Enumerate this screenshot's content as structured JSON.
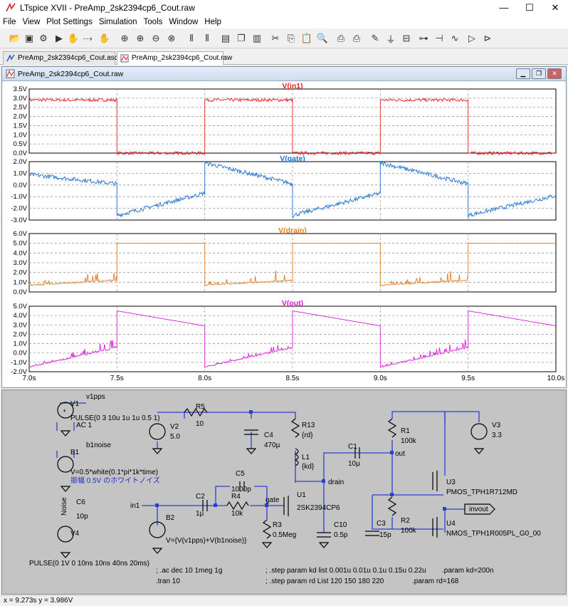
{
  "window": {
    "title": "LTspice XVII - PreAmp_2sk2394cp6_Cout.raw",
    "minimize": "—",
    "maximize": "☐",
    "close": "✕"
  },
  "menu": [
    "File",
    "View",
    "Plot Settings",
    "Simulation",
    "Tools",
    "Window",
    "Help"
  ],
  "toolbar_icons": [
    "open-icon",
    "save-icon",
    "settings-icon",
    "run-icon",
    "halt-icon",
    "run2-icon",
    "pan-icon",
    "zoom-in-icon",
    "zoom-in2-icon",
    "zoom-out-icon",
    "zoom-cancel-icon",
    "autorange-icon",
    "autorange2-icon",
    "tile-h-icon",
    "cascade-icon",
    "tile-v-icon",
    "cut-icon",
    "copy-icon",
    "paste-icon",
    "find-icon",
    "print-icon",
    "print-setup-icon",
    "pencil-icon",
    "ground-icon",
    "label-icon",
    "resistor-icon",
    "capacitor-icon",
    "inductor-icon",
    "diode-icon",
    "component-icon"
  ],
  "tabs": [
    {
      "label": "PreAmp_2sk2394cp6_Cout.asc"
    },
    {
      "label": "PreAmp_2sk2394cp6_Cout.raw"
    }
  ],
  "plot_window": {
    "title": "PreAmp_2sk2394cp6_Cout.raw"
  },
  "chart_data": [
    {
      "type": "line",
      "title": "V(in1)",
      "color": "#e8211e",
      "yticks": [
        "3.5V",
        "3.0V",
        "2.5V",
        "2.0V",
        "1.5V",
        "1.0V",
        "0.5V",
        "0.0V"
      ],
      "ylim": [
        0,
        3.5
      ],
      "xlim": [
        7.0,
        10.0
      ],
      "series": [
        {
          "name": "V(in1)",
          "segments": [
            [
              7.0,
              2.9
            ],
            [
              7.5,
              2.9
            ],
            [
              7.5,
              0.0
            ],
            [
              8.0,
              0.0
            ],
            [
              8.0,
              2.9
            ],
            [
              8.5,
              2.9
            ],
            [
              8.5,
              0.0
            ],
            [
              9.0,
              0.0
            ],
            [
              9.0,
              2.9
            ],
            [
              9.5,
              2.9
            ],
            [
              9.5,
              0.0
            ],
            [
              10.0,
              0.0
            ]
          ]
        }
      ]
    },
    {
      "type": "line",
      "title": "V(gate)",
      "color": "#1f6fd6",
      "yticks": [
        "2.0V",
        "1.0V",
        "0.0V",
        "-1.0V",
        "-2.0V",
        "-3.0V"
      ],
      "ylim": [
        -3.0,
        2.0
      ],
      "xlim": [
        7.0,
        10.0
      ],
      "series": [
        {
          "name": "V(gate)",
          "segments": [
            [
              7.0,
              0.9
            ],
            [
              7.5,
              0.1
            ],
            [
              7.5,
              -2.6
            ],
            [
              8.0,
              -0.7
            ],
            [
              8.0,
              1.9
            ],
            [
              8.5,
              0.1
            ],
            [
              8.5,
              -2.6
            ],
            [
              9.0,
              -0.7
            ],
            [
              9.0,
              1.9
            ],
            [
              9.5,
              0.1
            ],
            [
              9.5,
              -2.6
            ],
            [
              10.0,
              -0.9
            ]
          ]
        }
      ]
    },
    {
      "type": "line",
      "title": "V(drain)",
      "color": "#e87a1e",
      "yticks": [
        "6.0V",
        "5.0V",
        "4.0V",
        "3.0V",
        "2.0V",
        "1.0V",
        "0.0V"
      ],
      "ylim": [
        0,
        6.0
      ],
      "xlim": [
        7.0,
        10.0
      ],
      "series": [
        {
          "name": "V(drain)",
          "segments": [
            [
              7.0,
              0.7
            ],
            [
              7.5,
              1.2
            ],
            [
              7.5,
              5.0
            ],
            [
              8.0,
              5.0
            ],
            [
              8.0,
              0.7
            ],
            [
              8.5,
              1.2
            ],
            [
              8.5,
              5.0
            ],
            [
              9.0,
              5.0
            ],
            [
              9.0,
              0.7
            ],
            [
              9.5,
              1.2
            ],
            [
              9.5,
              5.0
            ],
            [
              10.0,
              5.0
            ]
          ]
        }
      ]
    },
    {
      "type": "line",
      "title": "V(out)",
      "color": "#d81bd8",
      "yticks": [
        "5.0V",
        "4.0V",
        "3.0V",
        "2.0V",
        "1.0V",
        "0.0V",
        "-1.0V",
        "-2.0V"
      ],
      "ylim": [
        -2.0,
        5.0
      ],
      "xlim": [
        7.0,
        10.0
      ],
      "xticks": [
        "7.0s",
        "7.5s",
        "8.0s",
        "8.5s",
        "9.0s",
        "9.5s",
        "10.0s"
      ],
      "series": [
        {
          "name": "V(out)",
          "segments": [
            [
              7.0,
              -1.5
            ],
            [
              7.5,
              0.6
            ],
            [
              7.5,
              4.5
            ],
            [
              8.0,
              2.9
            ],
            [
              8.0,
              -1.5
            ],
            [
              8.5,
              0.6
            ],
            [
              8.5,
              4.5
            ],
            [
              9.0,
              2.9
            ],
            [
              9.0,
              -1.5
            ],
            [
              9.5,
              0.6
            ],
            [
              9.5,
              4.5
            ],
            [
              10.0,
              2.9
            ]
          ]
        }
      ]
    }
  ],
  "schematic": {
    "labels": {
      "v1pps": "v1pps",
      "V1": "V1",
      "pulse1": "PULSE(0 3 10u 1u 1u 0.5 1)",
      "ac1": "AC 1",
      "R5": "R5",
      "R5v": "10",
      "V2": "V2",
      "V2v": "5.0",
      "C4": "C4",
      "C4v": "470µ",
      "R13": "R13",
      "R13v": "{rd}",
      "L1": "L1",
      "L1v": "{kd}",
      "C1": "C1",
      "C1v": "10µ",
      "out": "out",
      "R1": "R1",
      "R1v": "100k",
      "V3": "V3",
      "V3v": "3.3",
      "B1": "B1",
      "b1noise": "b1noise",
      "bexpr": "V=0.5*white(0.1*pi*1k*time)",
      "jpnote": "振幅 0.5V のホワイトノイズ",
      "C5": "C5",
      "C5v": "1000p",
      "R4": "R4",
      "R4v": "10k",
      "gate": "gate",
      "drain": "drain",
      "U1": "U1",
      "U1v": "2SK2394CP6",
      "U3": "U3",
      "U3v": "PMOS_TPH1R712MD",
      "invout": "invout",
      "in1": "in1",
      "C2": "C2",
      "C2v": "1µ",
      "B2": "B2",
      "R3": "R3",
      "R3v": "0.5Meg",
      "C10": "C10",
      "C10v": "0.5p",
      "C3": "C3",
      "C3v": "15p",
      "R2": "R2",
      "R2v": "100k",
      "U4": "U4",
      "U4v": "NMOS_TPH1R005PL_G0_00",
      "noise": "Noise",
      "C6": "C6",
      "C6v": "10p",
      "V4": "V4",
      "b2expr": "V={V(v1pps)+V(b1noise)}",
      "pulse4": "PULSE(0 1V 0 10ns 10ns 40ns 20ms)",
      "ac_cmd": "; .ac dec 10 1meg 1g",
      "tran_cmd": ".tran 10",
      "step1": "; .step param kd list 0.001u 0.01u 0.1u  0.15u  0.22u",
      "param_kd": ".param kd=200n",
      "step2": "; .step param rd  List 120 150 180 220",
      "param_rd": ".param rd=168"
    }
  },
  "status": {
    "cursor": "x = 9.273s    y = 3.986V"
  }
}
